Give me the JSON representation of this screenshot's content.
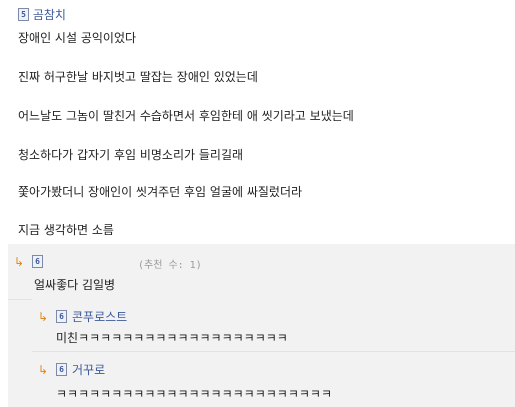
{
  "post": {
    "level_badge": "5",
    "author": "곰참치",
    "lines": [
      "장애인 시설 공익이었다",
      "진짜 허구한날 바지벗고 딸잡는 장애인 있었는데",
      "어느날도 그놈이 딸친거 수습하면서 후임한테 애 씻기라고 보냈는데",
      "청소하다가 갑자기 후임 비명소리가 들리길래",
      "쫓아가봤더니 장애인이 씻겨주던 후임 얼굴에 싸질렀더라",
      "지금 생각하면 소름"
    ]
  },
  "comments": [
    {
      "reply_arrow": "↳",
      "level_badge": "6",
      "author": "",
      "vote_label": "(추천 수: 1)",
      "text": "얼싸좋다 김일병"
    },
    {
      "reply_arrow": "↳",
      "level_badge": "6",
      "author": "콘푸로스트",
      "text": "미친ㅋㅋㅋㅋㅋㅋㅋㅋㅋㅋㅋㅋㅋㅋㅋㅋㅋㅋㅋ"
    },
    {
      "reply_arrow": "↳",
      "level_badge": "6",
      "author": "거꾸로",
      "text": "ㅋㅋㅋㅋㅋㅋㅋㅋㅋㅋㅋㅋㅋㅋㅋㅋㅋㅋㅋㅋㅋㅋㅋㅋㅋ"
    }
  ]
}
